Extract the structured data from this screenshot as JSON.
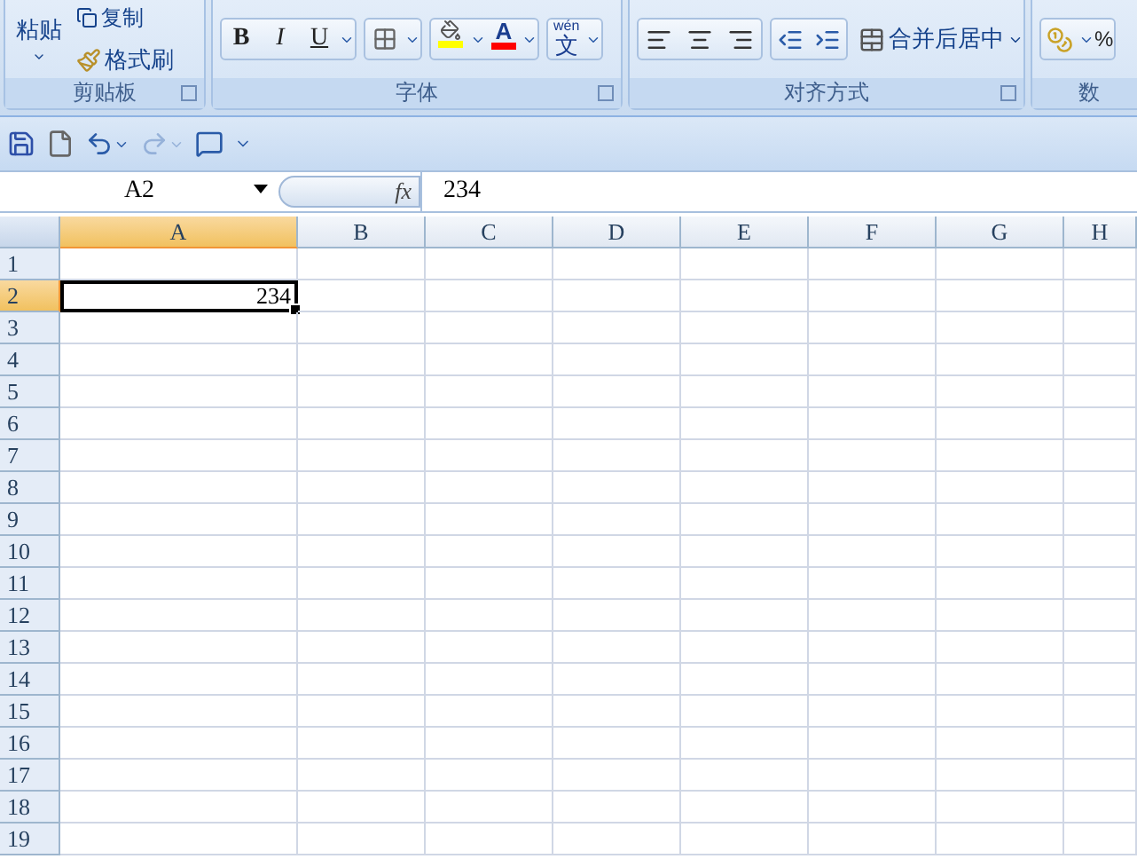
{
  "ribbon": {
    "groups": [
      {
        "kind": "clipboard",
        "label": "剪贴板",
        "paste": "粘贴",
        "copy": "复制",
        "format_painter": "格式刷"
      },
      {
        "kind": "font",
        "label": "字体",
        "bold": "B",
        "italic": "I",
        "underline": "U",
        "font_color": "A",
        "phonetic": "文",
        "phonetic_small": "wén"
      },
      {
        "kind": "align",
        "label": "对齐方式",
        "merge": "合并后居中"
      },
      {
        "kind": "number",
        "label": "数",
        "percent": "%"
      }
    ]
  },
  "quick_access": {
    "undo_enabled": true,
    "redo_enabled": false
  },
  "formula_bar": {
    "name_box": "A2",
    "fx": "fx",
    "value": "234"
  },
  "sheet": {
    "columns": [
      {
        "label": "A",
        "selected": true
      },
      {
        "label": "B",
        "selected": false
      },
      {
        "label": "C",
        "selected": false
      },
      {
        "label": "D",
        "selected": false
      },
      {
        "label": "E",
        "selected": false
      },
      {
        "label": "F",
        "selected": false
      },
      {
        "label": "G",
        "selected": false
      },
      {
        "label": "H",
        "selected": false
      }
    ],
    "rows": [
      {
        "label": "1",
        "selected": false
      },
      {
        "label": "2",
        "selected": true,
        "cells": [
          {
            "text": "234",
            "selected": true
          }
        ]
      },
      {
        "label": "3",
        "selected": false
      },
      {
        "label": "4",
        "selected": false
      },
      {
        "label": "5",
        "selected": false
      },
      {
        "label": "6",
        "selected": false
      },
      {
        "label": "7",
        "selected": false
      },
      {
        "label": "8",
        "selected": false
      },
      {
        "label": "9",
        "selected": false
      },
      {
        "label": "10",
        "selected": false
      },
      {
        "label": "11",
        "selected": false
      },
      {
        "label": "12",
        "selected": false
      },
      {
        "label": "13",
        "selected": false
      },
      {
        "label": "14",
        "selected": false
      },
      {
        "label": "15",
        "selected": false
      },
      {
        "label": "16",
        "selected": false
      },
      {
        "label": "17",
        "selected": false
      },
      {
        "label": "18",
        "selected": false
      },
      {
        "label": "19",
        "selected": false
      }
    ]
  }
}
